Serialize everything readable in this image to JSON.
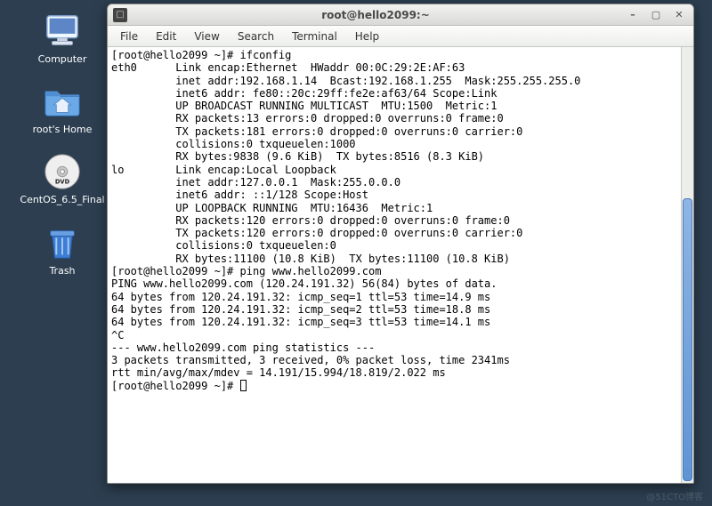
{
  "desktop": {
    "icons": [
      {
        "label": "Computer"
      },
      {
        "label": "root's Home"
      },
      {
        "label": "CentOS_6.5_Final"
      },
      {
        "label": "Trash"
      }
    ]
  },
  "window": {
    "title": "root@hello2099:~",
    "menu": [
      "File",
      "Edit",
      "View",
      "Search",
      "Terminal",
      "Help"
    ]
  },
  "terminal": {
    "lines": [
      "[root@hello2099 ~]# ifconfig",
      "eth0      Link encap:Ethernet  HWaddr 00:0C:29:2E:AF:63",
      "          inet addr:192.168.1.14  Bcast:192.168.1.255  Mask:255.255.255.0",
      "          inet6 addr: fe80::20c:29ff:fe2e:af63/64 Scope:Link",
      "          UP BROADCAST RUNNING MULTICAST  MTU:1500  Metric:1",
      "          RX packets:13 errors:0 dropped:0 overruns:0 frame:0",
      "          TX packets:181 errors:0 dropped:0 overruns:0 carrier:0",
      "          collisions:0 txqueuelen:1000",
      "          RX bytes:9838 (9.6 KiB)  TX bytes:8516 (8.3 KiB)",
      "",
      "lo        Link encap:Local Loopback",
      "          inet addr:127.0.0.1  Mask:255.0.0.0",
      "          inet6 addr: ::1/128 Scope:Host",
      "          UP LOOPBACK RUNNING  MTU:16436  Metric:1",
      "          RX packets:120 errors:0 dropped:0 overruns:0 frame:0",
      "          TX packets:120 errors:0 dropped:0 overruns:0 carrier:0",
      "          collisions:0 txqueuelen:0",
      "          RX bytes:11100 (10.8 KiB)  TX bytes:11100 (10.8 KiB)",
      "",
      "[root@hello2099 ~]# ping www.hello2099.com",
      "PING www.hello2099.com (120.24.191.32) 56(84) bytes of data.",
      "64 bytes from 120.24.191.32: icmp_seq=1 ttl=53 time=14.9 ms",
      "64 bytes from 120.24.191.32: icmp_seq=2 ttl=53 time=18.8 ms",
      "64 bytes from 120.24.191.32: icmp_seq=3 ttl=53 time=14.1 ms",
      "^C",
      "--- www.hello2099.com ping statistics ---",
      "3 packets transmitted, 3 received, 0% packet loss, time 2341ms",
      "rtt min/avg/max/mdev = 14.191/15.994/18.819/2.022 ms"
    ],
    "prompt": "[root@hello2099 ~]# "
  },
  "watermark": "@51CTO博客"
}
